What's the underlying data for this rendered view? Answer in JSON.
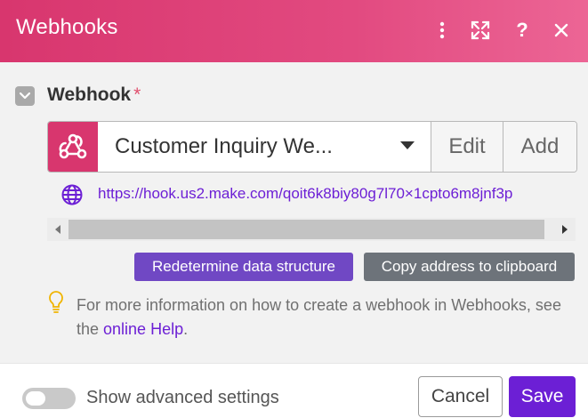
{
  "header": {
    "title": "Webhooks",
    "actions": [
      "more-vertical-icon",
      "expand-icon",
      "help-icon",
      "close-icon"
    ],
    "colors": {
      "from": "#d8366e",
      "to": "#ec6595"
    }
  },
  "field": {
    "label": "Webhook",
    "required_mark": "*",
    "selected_hook": "Customer Inquiry We...",
    "edit_label": "Edit",
    "add_label": "Add",
    "url": "https://hook.us2.make.com/qoit6k8biy80g7l70×1cpto6m8jnf3p"
  },
  "actions": {
    "redetermine_label": "Redetermine data structure",
    "copy_label": "Copy address to clipboard"
  },
  "info": {
    "text_before": "For more information on how to create a webhook in Webhooks, see the ",
    "link_text": "online Help",
    "text_after": "."
  },
  "footer": {
    "advanced_label": "Show advanced settings",
    "advanced_enabled": false,
    "cancel_label": "Cancel",
    "save_label": "Save"
  },
  "colors": {
    "accent_purple": "#6c1fd5",
    "redetermine_bg": "#7048c4",
    "copy_bg": "#6d737a",
    "hook_icon_bg": "#d8366e"
  }
}
